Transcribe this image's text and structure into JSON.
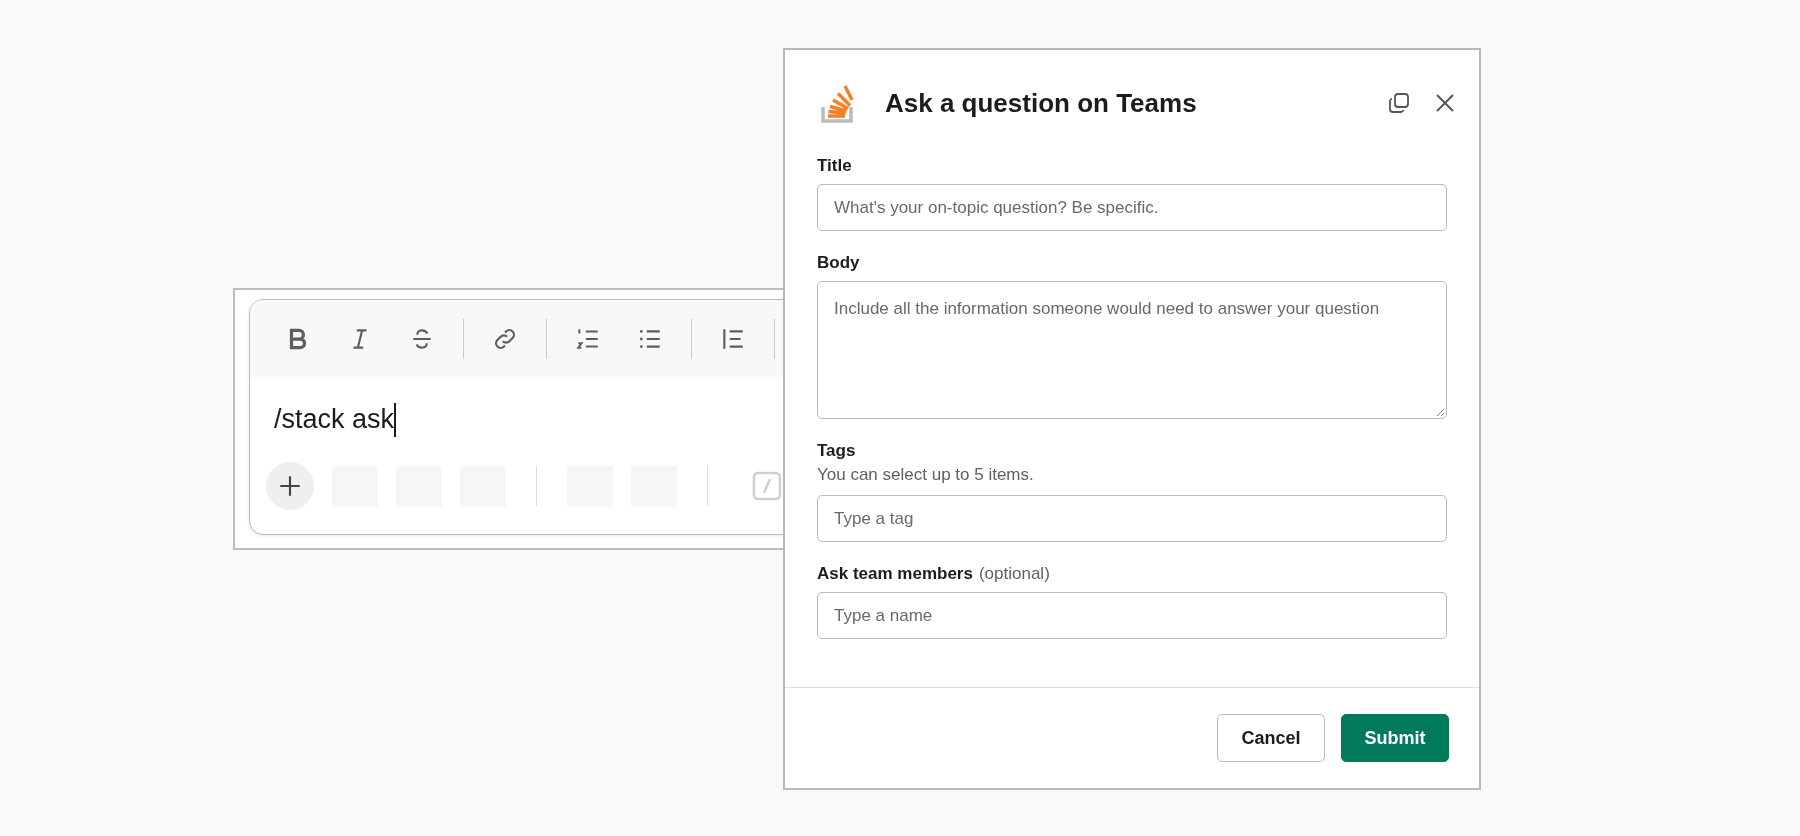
{
  "composer": {
    "message": "/stack ask"
  },
  "dialog": {
    "title": "Ask a question on Teams",
    "fields": [
      {
        "kind": "input",
        "label": "Title",
        "placeholder": "What's your on-topic question? Be specific."
      },
      {
        "kind": "textarea",
        "label": "Body",
        "placeholder": "Include all the information someone would need to answer your question"
      },
      {
        "kind": "input",
        "label": "Tags",
        "hint": "You can select up to 5 items.",
        "placeholder": "Type a tag"
      },
      {
        "kind": "input",
        "label": "Ask team members",
        "note": "(optional)",
        "placeholder": "Type a name"
      }
    ],
    "buttons": [
      {
        "kind": "secondary",
        "label": "Cancel"
      },
      {
        "kind": "primary",
        "label": "Submit"
      }
    ]
  }
}
